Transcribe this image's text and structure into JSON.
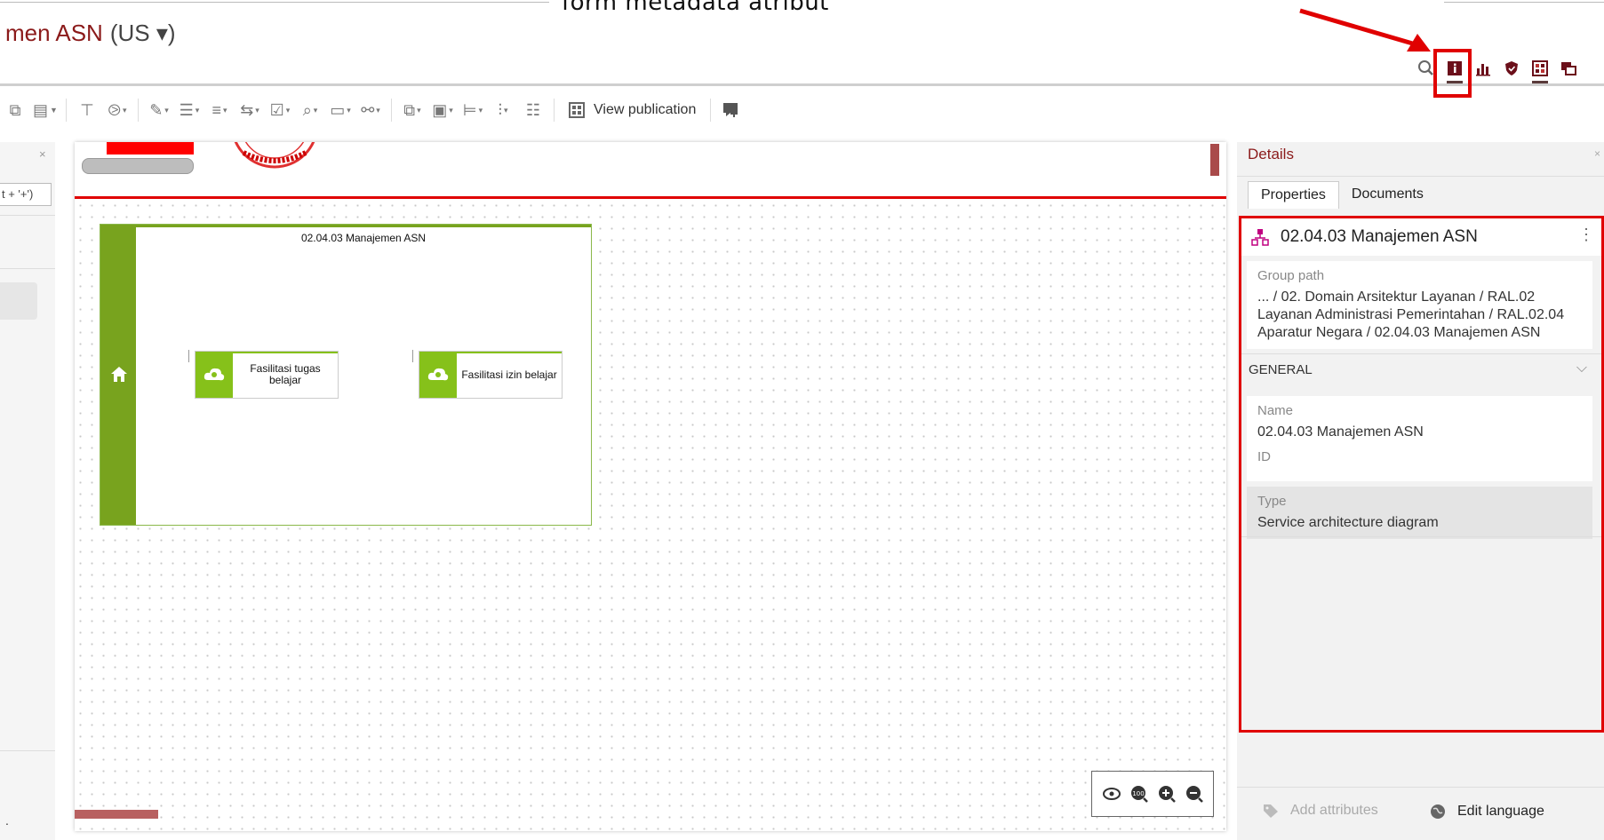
{
  "annotation": {
    "caption": "form metadata atribut"
  },
  "header": {
    "title": "men ASN",
    "language": "(US ▾)"
  },
  "header_icons": [
    "search-icon",
    "info-icon",
    "chart-icon",
    "shield-icon",
    "diagram-icon",
    "chat-icon"
  ],
  "toolbar": {
    "view_publication_label": "View publication"
  },
  "left_panel": {
    "search_value": "t + '+')",
    "close_label": "×",
    "bottom_text": "."
  },
  "canvas": {
    "group": {
      "title": "02.04.03 Manajemen ASN",
      "services": [
        {
          "label": "Fasilitasi tugas belajar"
        },
        {
          "label": "Fasilitasi izin belajar"
        }
      ]
    }
  },
  "details": {
    "title": "Details",
    "close_label": "×",
    "tabs": [
      {
        "label": "Properties",
        "active": true
      },
      {
        "label": "Documents",
        "active": false
      }
    ],
    "object_name": "02.04.03 Manajemen ASN",
    "group_path": {
      "label": "Group path",
      "value": "... / 02. Domain Arsitektur Layanan / RAL.02 Layanan Administrasi Pemerintahan / RAL.02.04 Aparatur Negara / 02.04.03 Manajemen ASN"
    },
    "section_general": "GENERAL",
    "fields": {
      "name": {
        "label": "Name",
        "value": "02.04.03 Manajemen ASN"
      },
      "id": {
        "label": "ID",
        "value": ""
      },
      "type": {
        "label": "Type",
        "value": "Service architecture diagram"
      }
    },
    "footer": {
      "add_attributes": "Add attributes",
      "edit_language": "Edit language"
    }
  },
  "colors": {
    "accent": "#8b1a1a",
    "highlight": "#e00000",
    "group_green": "#78a31e",
    "service_green": "#86c11a"
  }
}
